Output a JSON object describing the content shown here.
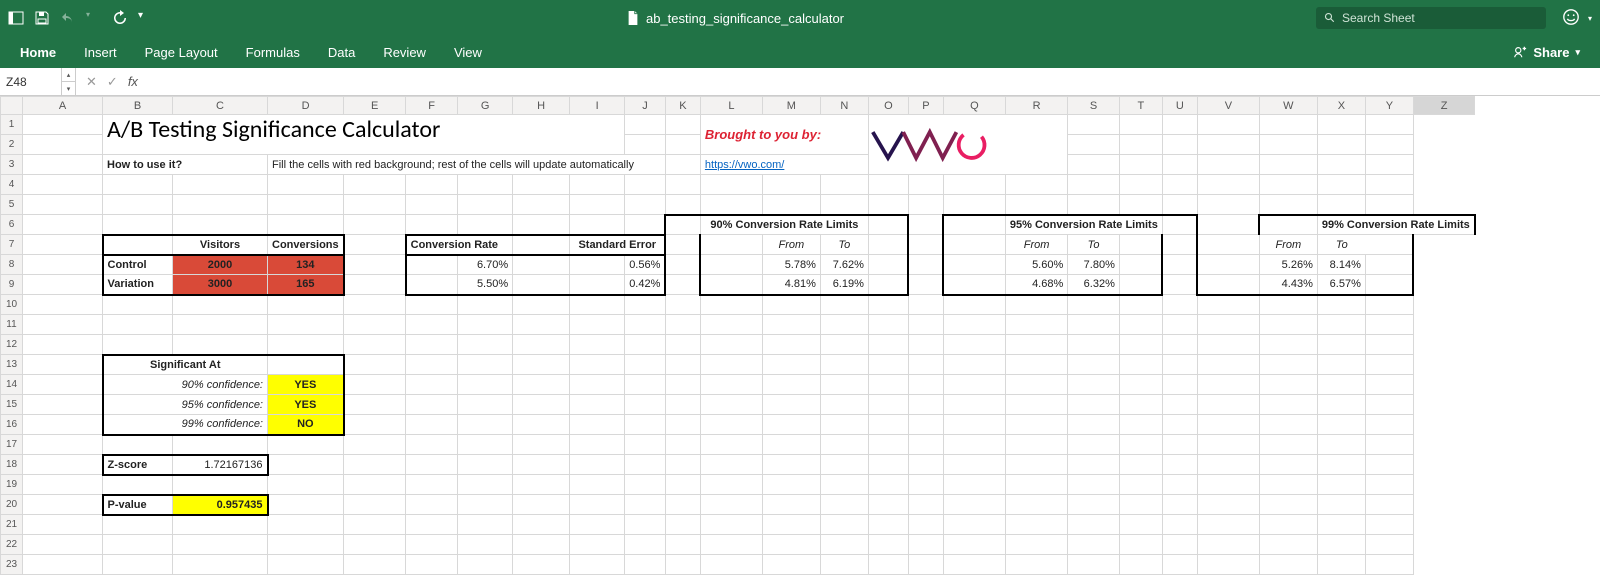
{
  "app": {
    "filename": "ab_testing_significance_calculator",
    "search_placeholder": "Search Sheet"
  },
  "tabs": {
    "home": "Home",
    "insert": "Insert",
    "layout": "Page Layout",
    "formulas": "Formulas",
    "data": "Data",
    "review": "Review",
    "view": "View",
    "share": "Share"
  },
  "formula_bar": {
    "cell_ref": "Z48",
    "formula": ""
  },
  "columns": [
    "A",
    "B",
    "C",
    "D",
    "E",
    "F",
    "G",
    "H",
    "I",
    "J",
    "K",
    "L",
    "M",
    "N",
    "O",
    "P",
    "Q",
    "R",
    "S",
    "T",
    "U",
    "V",
    "W",
    "X",
    "Y",
    "Z"
  ],
  "content": {
    "title": "A/B Testing Significance Calculator",
    "brought": "Brought to you by:",
    "howto_label": "How to use it?",
    "howto_text": "Fill the cells with red background; rest of the cells will update automatically",
    "url": "https://vwo.com/",
    "visitors_hdr": "Visitors",
    "conversions_hdr": "Conversions",
    "control_label": "Control",
    "variation_label": "Variation",
    "control_visitors": "2000",
    "control_conversions": "134",
    "variation_visitors": "3000",
    "variation_conversions": "165",
    "conv_rate_hdr": "Conversion Rate",
    "std_err_hdr": "Standard Error",
    "conv_rate_control": "6.70%",
    "conv_rate_variation": "5.50%",
    "std_err_control": "0.56%",
    "std_err_variation": "0.42%",
    "limits90_hdr": "90% Conversion Rate Limits",
    "limits95_hdr": "95% Conversion Rate Limits",
    "limits99_hdr": "99% Conversion Rate Limits",
    "from": "From",
    "to": "To",
    "l90": {
      "cf": "5.78%",
      "ct": "7.62%",
      "vf": "4.81%",
      "vt": "6.19%"
    },
    "l95": {
      "cf": "5.60%",
      "ct": "7.80%",
      "vf": "4.68%",
      "vt": "6.32%"
    },
    "l99": {
      "cf": "5.26%",
      "ct": "8.14%",
      "vf": "4.43%",
      "vt": "6.57%"
    },
    "sig_at": "Significant At",
    "conf90": "90% confidence:",
    "conf95": "95% confidence:",
    "conf99": "99% confidence:",
    "sig90": "YES",
    "sig95": "YES",
    "sig99": "NO",
    "zscore_label": "Z-score",
    "zscore_val": "1.72167136",
    "pvalue_label": "P-value",
    "pvalue_val": "0.957435"
  }
}
